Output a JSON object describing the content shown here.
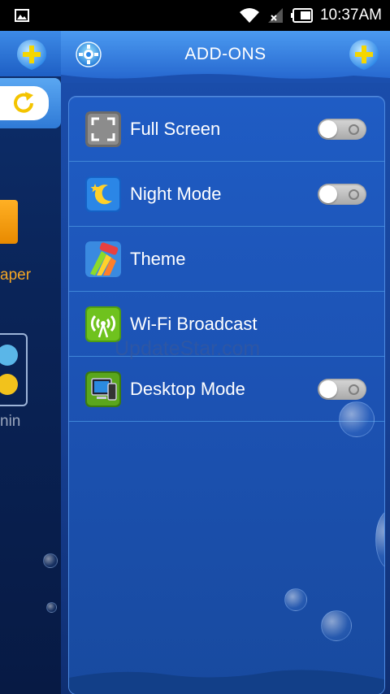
{
  "status_bar": {
    "time": "10:37AM",
    "icons": [
      "gallery-icon",
      "wifi-icon",
      "no-signal-icon",
      "battery-icon"
    ]
  },
  "left_panel": {
    "wallpaper_label_fragment": "aper",
    "admin_label_fragment": "nin"
  },
  "header": {
    "title": "ADD-ONS"
  },
  "addons": [
    {
      "label": "Full Screen",
      "icon": "fullscreen-icon",
      "has_toggle": true,
      "enabled": false
    },
    {
      "label": "Night Mode",
      "icon": "night-mode-icon",
      "has_toggle": true,
      "enabled": false
    },
    {
      "label": "Theme",
      "icon": "theme-icon",
      "has_toggle": false
    },
    {
      "label": "Wi-Fi Broadcast",
      "icon": "wifi-broadcast-icon",
      "has_toggle": false
    },
    {
      "label": "Desktop Mode",
      "icon": "desktop-mode-icon",
      "has_toggle": true,
      "enabled": false
    }
  ],
  "watermark": "UpdateStar.com",
  "colors": {
    "accent": "#2667cf",
    "panel": "#1c52b3",
    "wallpaper_orange": "#f5a623"
  }
}
